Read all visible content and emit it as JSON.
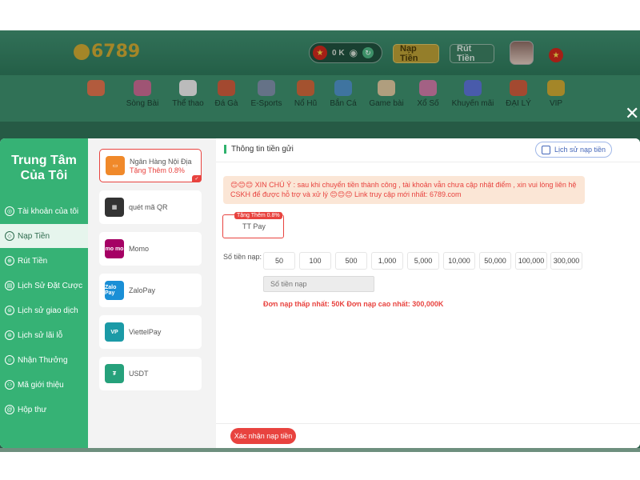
{
  "header": {
    "logo_text": "6789",
    "balance": "0 K",
    "deposit_label": "Nạp Tiền",
    "withdraw_label": "Rút Tiền"
  },
  "nav": {
    "items": [
      {
        "label": "",
        "icon": "home-icon",
        "color": "#d9704b"
      },
      {
        "label": "Sòng Bài",
        "icon": "casino-icon",
        "color": "#c2678e"
      },
      {
        "label": "Thể thao",
        "icon": "soccer-icon",
        "color": "#e5e5e5"
      },
      {
        "label": "Đá Gà",
        "icon": "rooster-icon",
        "color": "#c75a3b"
      },
      {
        "label": "E-Sports",
        "icon": "gamepad-icon",
        "color": "#7c8ba5"
      },
      {
        "label": "Nổ Hũ",
        "icon": "jackpot-icon",
        "color": "#c9653a"
      },
      {
        "label": "Bắn Cá",
        "icon": "fish-icon",
        "color": "#4d8ec4"
      },
      {
        "label": "Game bài",
        "icon": "cards-icon",
        "color": "#d7c19a"
      },
      {
        "label": "Xổ Số",
        "icon": "lottery-icon",
        "color": "#c777a1"
      },
      {
        "label": "Khuyến mãi",
        "icon": "gift-icon",
        "color": "#5a6fd1"
      },
      {
        "label": "ĐẠI LÝ",
        "icon": "agent-icon",
        "color": "#c75a3b"
      },
      {
        "label": "VIP",
        "icon": "crown-icon",
        "color": "#c9a431"
      }
    ]
  },
  "sidebar": {
    "title_line1": "Trung Tâm",
    "title_line2": "Của Tôi",
    "items": [
      {
        "label": "Tài khoản của tôi",
        "glyph": "◎"
      },
      {
        "label": "Nạp Tiền",
        "glyph": "◇"
      },
      {
        "label": "Rút Tiền",
        "glyph": "⊕"
      },
      {
        "label": "Lịch Sử Đặt Cược",
        "glyph": "▤"
      },
      {
        "label": "Lịch sử giao dịch",
        "glyph": "⊜"
      },
      {
        "label": "Lịch sử lãi lỗ",
        "glyph": "⊜"
      },
      {
        "label": "Nhận Thưởng",
        "glyph": "☺"
      },
      {
        "label": "Mã giới thiệu",
        "glyph": "⚇"
      },
      {
        "label": "Hộp thư",
        "glyph": "@"
      }
    ]
  },
  "methods": [
    {
      "label": "Ngân Hàng Nội Địa",
      "sub": "Tặng Thêm 0.8%",
      "icon": "bank-card-icon",
      "color": "#f0892a",
      "icon_text": "▭"
    },
    {
      "label": "quét mã QR",
      "sub": "",
      "icon": "qr-phone-icon",
      "color": "#333333",
      "icon_text": "▦"
    },
    {
      "label": "Momo",
      "sub": "",
      "icon": "momo-icon",
      "color": "#a50064",
      "icon_text": "mo mo"
    },
    {
      "label": "ZaloPay",
      "sub": "",
      "icon": "zalopay-icon",
      "color": "#1a8fd6",
      "icon_text": "Zalo Pay"
    },
    {
      "label": "ViettelPay",
      "sub": "",
      "icon": "viettelpay-icon",
      "color": "#1b9aa6",
      "icon_text": "VP"
    },
    {
      "label": "USDT",
      "sub": "",
      "icon": "usdt-icon",
      "color": "#26a17b",
      "icon_text": "₮"
    }
  ],
  "content": {
    "title": "Thông tin tiền gửi",
    "history_label": "Lịch sử nạp tiền",
    "notice": "😊😊😊 XIN CHÚ Ý : sau khi chuyển tiền thành công , tài khoản vẫn chưa cập nhật điểm , xin vui lòng liên hệ CSKH để được hỗ trợ và xử lý 😊😊😊 Link truy cập mới nhất: 6789.com",
    "channel_tag": "Tặng Thêm 0.8%",
    "channel_label": "TT Pay",
    "amount_label": "Số tiền nạp:",
    "amounts": [
      "50",
      "100",
      "500",
      "1,000",
      "5,000",
      "10,000",
      "50,000",
      "100,000",
      "300,000"
    ],
    "amount_placeholder": "Số tiền nạp",
    "limits": "Đơn nạp thấp nhất:  50K   Đơn nạp cao nhất:  300,000K",
    "confirm_label": "Xác nhận nạp tiền"
  }
}
